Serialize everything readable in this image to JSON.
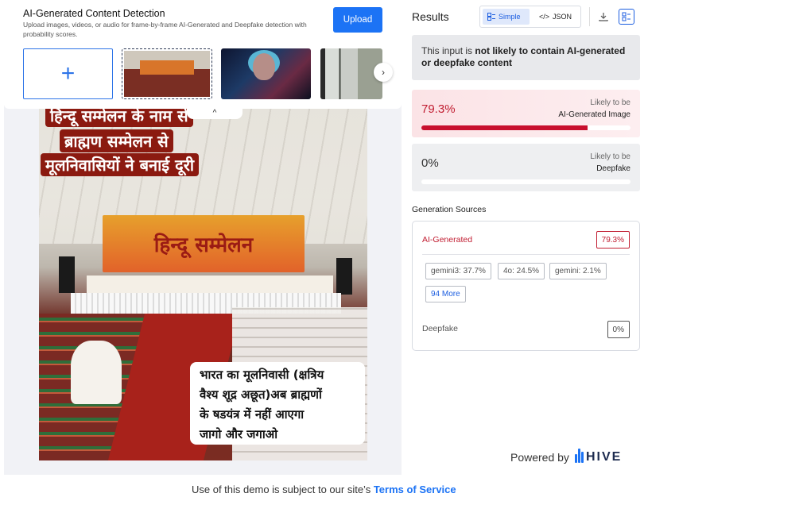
{
  "header": {
    "title": "AI-Generated Content Detection",
    "subtitle": "Upload images, videos, or audio for frame-by-frame AI-Generated and Deepfake detection with probability scores.",
    "upload_label": "Upload"
  },
  "thumbnails": {
    "add_symbol": "+",
    "selected_banner_text": "हिन्दू सम्मेलन"
  },
  "preview": {
    "collapse_symbol": "^",
    "overlay_lines": [
      "हिन्दू सम्मेलन के नाम से",
      "ब्राह्मण सम्मेलन से",
      "मूलनिवासियों ने बनाई दूरी"
    ],
    "banner_text": "हिन्दू सम्मेलन",
    "box_lines": [
      "भारत का मूलनिवासी (क्षत्रिय",
      "वैश्य शूद्र अछूत)अब ब्राह्मणों",
      "के षडयंत्र में नहीं आएगा",
      "जागो और  जगाओ"
    ]
  },
  "results": {
    "title": "Results",
    "view_simple": "Simple",
    "view_json": "JSON",
    "verdict_prefix": "This input is ",
    "verdict_bold": "not likely to contain AI-generated or deepfake content",
    "scores": [
      {
        "value": "79.3%",
        "fraction": 0.793,
        "caption": "Likely to be",
        "label": "AI-Generated Image"
      },
      {
        "value": "0%",
        "fraction": 0.0,
        "caption": "Likely to be",
        "label": "Deepfake"
      }
    ],
    "sources_title": "Generation Sources",
    "ai_label": "AI-Generated",
    "ai_pct": "79.3%",
    "chips": [
      "gemini3: 37.7%",
      "4o: 24.5%",
      "gemini: 2.1%"
    ],
    "more": "94 More",
    "df_label": "Deepfake",
    "df_pct": "0%"
  },
  "branding": {
    "powered_by": "Powered by",
    "brand": "HIVE"
  },
  "footer": {
    "text": "Use of this demo is subject to our site’s ",
    "link": "Terms of Service"
  },
  "colors": {
    "accent": "#1c73f5",
    "danger": "#c11d31"
  }
}
